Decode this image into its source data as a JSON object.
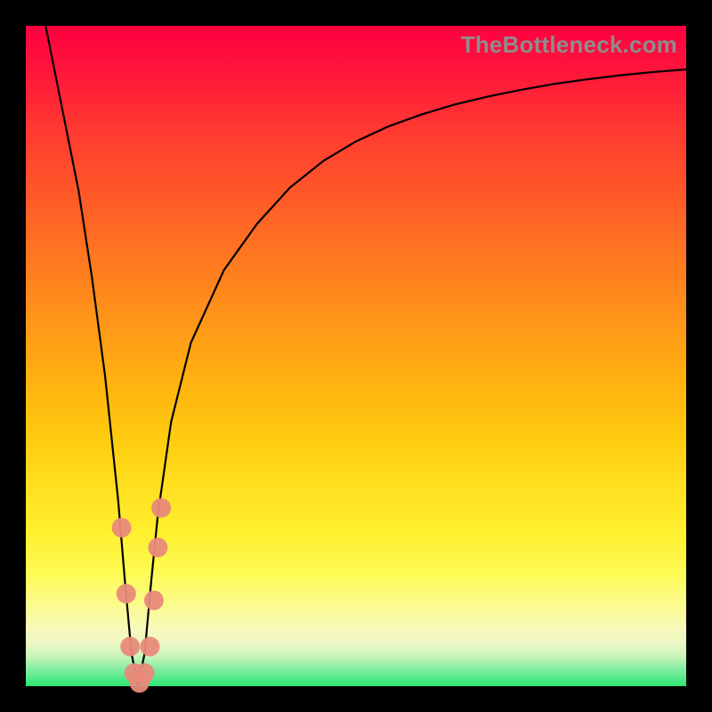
{
  "watermark": "TheBottleneck.com",
  "colors": {
    "curve_stroke": "#000000",
    "marker_fill": "#E88A7A",
    "plot_bg_top": "#ff0040",
    "plot_bg_bottom": "#2BE673",
    "page_bg": "#000000",
    "watermark_text": "#8d8d8d"
  },
  "chart_data": {
    "type": "line",
    "title": "",
    "xlabel": "",
    "ylabel": "",
    "xlim": [
      0,
      100
    ],
    "ylim": [
      0,
      100
    ],
    "x": [
      3,
      5,
      8,
      10,
      12,
      14,
      15,
      16,
      17,
      18,
      19,
      20,
      22,
      25,
      30,
      35,
      40,
      45,
      50,
      55,
      60,
      65,
      70,
      75,
      80,
      85,
      90,
      95,
      100
    ],
    "values": [
      100,
      90,
      75,
      62,
      47,
      28,
      16,
      5,
      0,
      5,
      16,
      26,
      40,
      52,
      63,
      70,
      75.5,
      79.5,
      82.5,
      84.8,
      86.6,
      88.1,
      89.3,
      90.3,
      91.2,
      91.9,
      92.5,
      93,
      93.4
    ],
    "minimum_x": 17,
    "markers": [
      {
        "x": 14.5,
        "y": 24
      },
      {
        "x": 15.2,
        "y": 14
      },
      {
        "x": 15.8,
        "y": 6
      },
      {
        "x": 16.4,
        "y": 2
      },
      {
        "x": 17.2,
        "y": 0.5
      },
      {
        "x": 18.0,
        "y": 2
      },
      {
        "x": 18.8,
        "y": 6
      },
      {
        "x": 19.4,
        "y": 13
      },
      {
        "x": 20.0,
        "y": 21
      },
      {
        "x": 20.5,
        "y": 27
      }
    ]
  }
}
